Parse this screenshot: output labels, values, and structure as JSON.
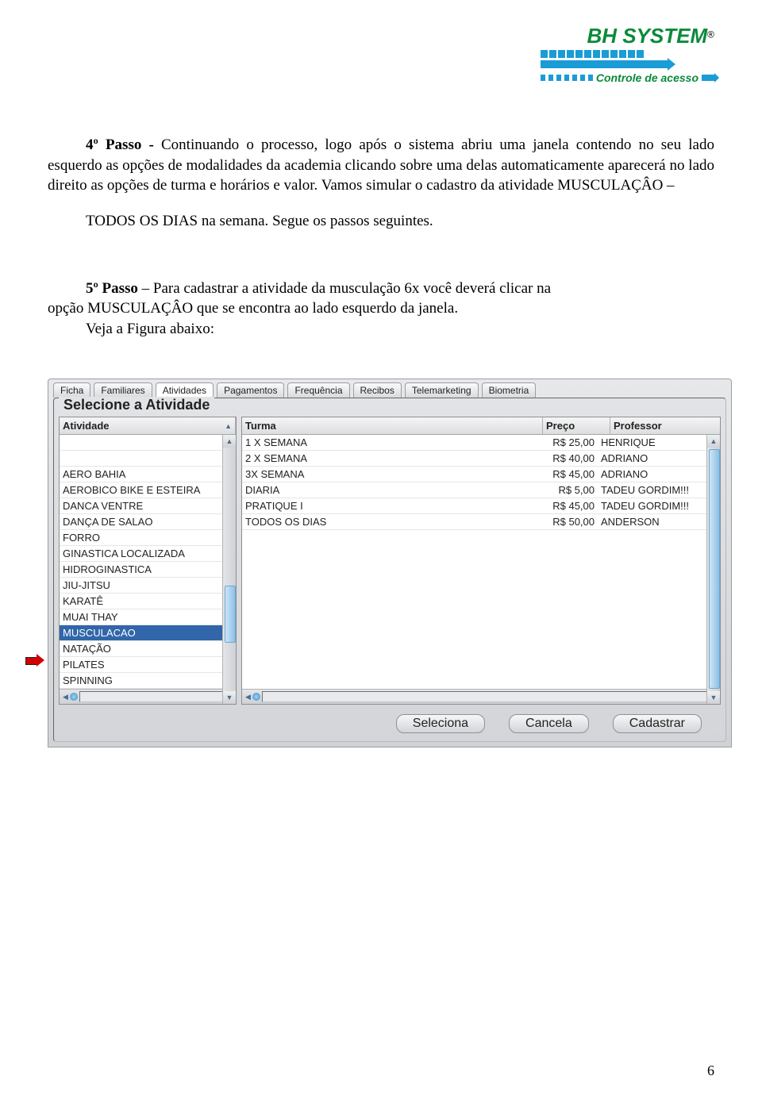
{
  "logo": {
    "brand": "BH SYSTEM",
    "regmark": "®",
    "tagline": "Controle de acesso"
  },
  "text": {
    "p1": "4º Passo - Continuando o processo, logo após o sistema abriu uma janela contendo no seu lado esquerdo as opções de modalidades da academia clicando sobre uma delas automaticamente aparecerá no lado direito as opções de turma e horários e valor. Vamos simular o cadastro da atividade MUSCULAÇÂO – TODOS OS DIAS na semana. Segue os passos seguintes.",
    "p2": "5º Passo – Para cadastrar a atividade da musculação 6x você deverá clicar na opção MUSCULAÇÂO que se encontra ao lado esquerdo da janela.",
    "p3": "Veja a Figura abaixo:"
  },
  "ui": {
    "tabs": [
      "Ficha",
      "Familiares",
      "Atividades",
      "Pagamentos",
      "Frequência",
      "Recibos",
      "Telemarketing",
      "Biometria"
    ],
    "group_title": "Selecione a Atividade",
    "headers": {
      "atividade": "Atividade",
      "turma": "Turma",
      "preco": "Preço",
      "professor": "Professor"
    },
    "atividades": [
      "",
      "",
      "AERO BAHIA",
      "AEROBICO BIKE E ESTEIRA",
      "DANCA VENTRE",
      "DANÇA DE SALAO",
      "FORRO",
      "GINASTICA LOCALIZADA",
      "HIDROGINASTICA",
      "JIU-JITSU",
      "KARATÊ",
      "MUAI THAY",
      "MUSCULACAO",
      "NATAÇÃO",
      "PILATES",
      "SPINNING"
    ],
    "atividade_selected_index": 12,
    "turmas": [
      {
        "turma": "1 X SEMANA",
        "preco": "R$ 25,00",
        "prof": "HENRIQUE"
      },
      {
        "turma": "2 X SEMANA",
        "preco": "R$ 40,00",
        "prof": "ADRIANO"
      },
      {
        "turma": "3X SEMANA",
        "preco": "R$ 45,00",
        "prof": "ADRIANO"
      },
      {
        "turma": "DIARIA",
        "preco": "R$ 5,00",
        "prof": "TADEU  GORDIM!!!"
      },
      {
        "turma": "PRATIQUE I",
        "preco": "R$ 45,00",
        "prof": "TADEU  GORDIM!!!"
      },
      {
        "turma": "TODOS OS DIAS",
        "preco": "R$ 50,00",
        "prof": "ANDERSON"
      }
    ],
    "buttons": {
      "seleciona": "Seleciona",
      "cancela": "Cancela",
      "cadastrar": "Cadastrar"
    }
  },
  "page_number": "6"
}
